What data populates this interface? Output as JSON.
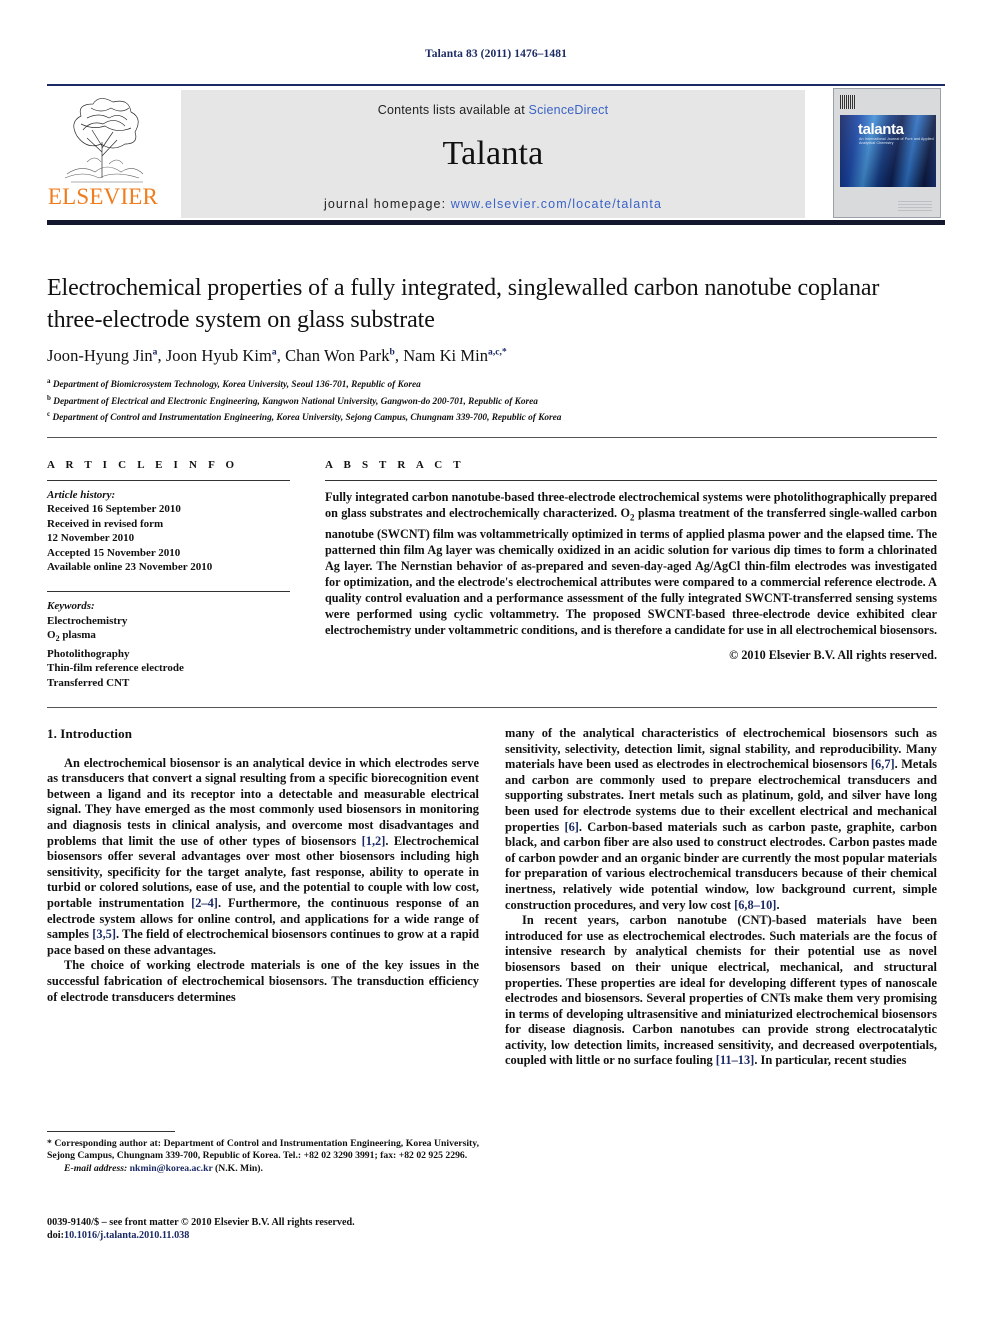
{
  "running_head": "Talanta 83 (2011) 1476–1481",
  "masthead": {
    "contents_prefix": "Contents lists available at ",
    "sciencedirect": "ScienceDirect",
    "journal_title": "Talanta",
    "homepage_label": "journal homepage: ",
    "homepage_url": "www.elsevier.com/locate/talanta",
    "publisher": "ELSEVIER",
    "cover_title": "talanta",
    "cover_subtitle": "An International Journal of Pure and Applied Analytical Chemistry",
    "link_color": "#3a63c6",
    "accent_color": "#1b2a63",
    "elsevier_orange": "#f07c1e"
  },
  "article": {
    "title": "Electrochemical properties of a fully integrated, singlewalled carbon nanotube coplanar three-electrode system on glass substrate",
    "authors_html": "Joon-Hyung Jin<sup>a</sup>, Joon Hyub Kim<sup>a</sup>, Chan Won Park<sup>b</sup>, Nam Ki Min<sup>a,c,</sup><sup>*</sup>",
    "affiliations": [
      "Department of Biomicrosystem Technology, Korea University, Seoul 136-701, Republic of Korea",
      "Department of Electrical and Electronic Engineering, Kangwon National University, Gangwon-do 200-701, Republic of Korea",
      "Department of Control and Instrumentation Engineering, Korea University, Sejong Campus, Chungnam 339-700, Republic of Korea"
    ],
    "affiliation_marks": [
      "a",
      "b",
      "c"
    ]
  },
  "info": {
    "heading": "A R T I C L E    I N F O",
    "history_label": "Article history:",
    "history": [
      "Received 16 September 2010",
      "Received in revised form",
      "12 November 2010",
      "Accepted 15 November 2010",
      "Available online 23 November 2010"
    ],
    "keywords_label": "Keywords:",
    "keywords": [
      "Electrochemistry",
      "O2 plasma",
      "Photolithography",
      "Thin-film reference electrode",
      "Transferred CNT"
    ]
  },
  "abstract": {
    "heading": "A B S T R A C T",
    "text": "Fully integrated carbon nanotube-based three-electrode electrochemical systems were photolithographically prepared on glass substrates and electrochemically characterized. O2 plasma treatment of the transferred single-walled carbon nanotube (SWCNT) film was voltammetrically optimized in terms of applied plasma power and the elapsed time. The patterned thin film Ag layer was chemically oxidized in an acidic solution for various dip times to form a chlorinated Ag layer. The Nernstian behavior of as-prepared and seven-day-aged Ag/AgCl thin-film electrodes was investigated for optimization, and the electrode's electrochemical attributes were compared to a commercial reference electrode. A quality control evaluation and a performance assessment of the fully integrated SWCNT-transferred sensing systems were performed using cyclic voltammetry. The proposed SWCNT-based three-electrode device exhibited clear electrochemistry under voltammetric conditions, and is therefore a candidate for use in all electrochemical biosensors.",
    "copyright": "© 2010 Elsevier B.V. All rights reserved."
  },
  "body": {
    "section_heading": "1.  Introduction",
    "left_paragraphs": [
      "An electrochemical biosensor is an analytical device in which electrodes serve as transducers that convert a signal resulting from a specific biorecognition event between a ligand and its receptor into a detectable and measurable electrical signal. They have emerged as the most commonly used biosensors in monitoring and diagnosis tests in clinical analysis, and overcome most disadvantages and problems that limit the use of other types of biosensors [1,2]. Electrochemical biosensors offer several advantages over most other biosensors including high sensitivity, specificity for the target analyte, fast response, ability to operate in turbid or colored solutions, ease of use, and the potential to couple with low cost, portable instrumentation [2–4]. Furthermore, the continuous response of an electrode system allows for online control, and applications for a wide range of samples [3,5]. The field of electrochemical biosensors continues to grow at a rapid pace based on these advantages.",
      "The choice of working electrode materials is one of the key issues in the successful fabrication of electrochemical biosensors. The transduction efficiency of electrode transducers determines"
    ],
    "right_paragraphs": [
      "many of the analytical characteristics of electrochemical biosensors such as sensitivity, selectivity, detection limit, signal stability, and reproducibility. Many materials have been used as electrodes in electrochemical biosensors [6,7]. Metals and carbon are commonly used to prepare electrochemical transducers and supporting substrates. Inert metals such as platinum, gold, and silver have long been used for electrode systems due to their excellent electrical and mechanical properties [6]. Carbon-based materials such as carbon paste, graphite, carbon black, and carbon fiber are also used to construct electrodes. Carbon pastes made of carbon powder and an organic binder are currently the most popular materials for preparation of various electrochemical transducers because of their chemical inertness, relatively wide potential window, low background current, simple construction procedures, and very low cost [6,8–10].",
      "In recent years, carbon nanotube (CNT)-based materials have been introduced for use as electrochemical electrodes. Such materials are the focus of intensive research by analytical chemists for their potential use as novel biosensors based on their unique electrical, mechanical, and structural properties. These properties are ideal for developing different types of nanoscale electrodes and biosensors. Several properties of CNTs make them very promising in terms of developing ultrasensitive and miniaturized electrochemical biosensors for disease diagnosis. Carbon nanotubes can provide strong electrocatalytic activity, low detection limits, increased sensitivity, and decreased overpotentials, coupled with little or no surface fouling [11–13]. In particular, recent studies"
    ]
  },
  "footnote": {
    "corresponding": "* Corresponding author at: Department of Control and Instrumentation Engineering, Korea University, Sejong Campus, Chungnam 339-700, Republic of Korea. Tel.: +82 02 3290 3991; fax: +82 02 925 2296.",
    "email_label": "E-mail address:",
    "email": "nkmin@korea.ac.kr",
    "email_suffix": "(N.K. Min)."
  },
  "colophon": {
    "line1": "0039-9140/$ – see front matter © 2010 Elsevier B.V. All rights reserved.",
    "doi_label": "doi:",
    "doi": "10.1016/j.talanta.2010.11.038"
  }
}
